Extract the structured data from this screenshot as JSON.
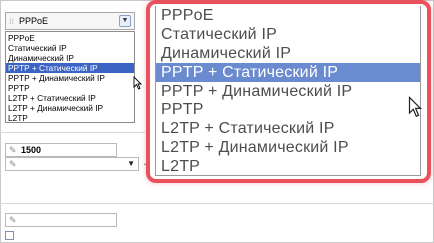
{
  "select": {
    "value": "PPPoE"
  },
  "connection_types": [
    "PPPoE",
    "Статический IP",
    "Динамический IP",
    "PPTP + Статический IP",
    "PPTP + Динамический IP",
    "PPTP",
    "L2TP + Статический IP",
    "L2TP + Динамический IP",
    "L2TP"
  ],
  "selected_index": 3,
  "mtu_field": {
    "value": "1500"
  },
  "colors": {
    "highlight_small": "#3b64c4",
    "highlight_zoom": "#6b8bd0",
    "zoom_border": "#e9515c"
  }
}
